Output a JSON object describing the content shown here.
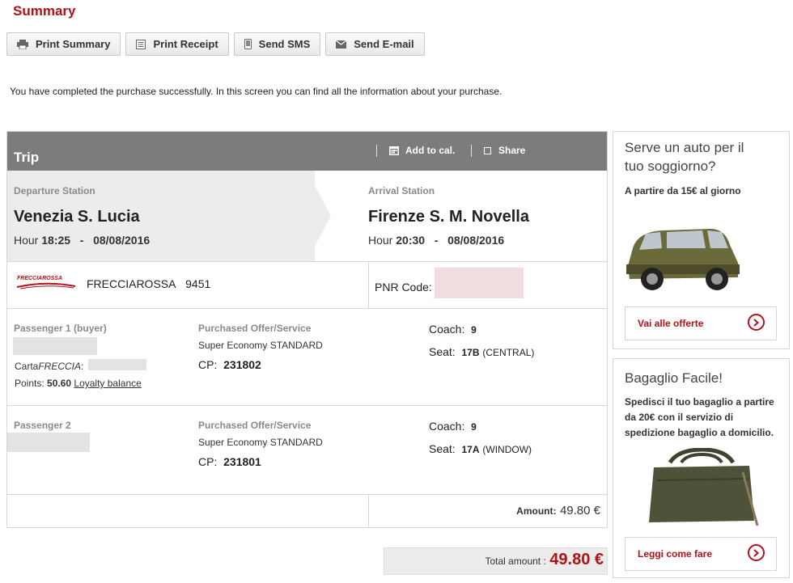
{
  "page": {
    "title": "Summary"
  },
  "toolbar": {
    "print_summary": "Print Summary",
    "print_receipt": "Print Receipt",
    "send_sms": "Send SMS",
    "send_email": "Send E-mail"
  },
  "message": "You have completed the purchase successfully. In this screen you can find all the information about your purchase.",
  "trip": {
    "header": "Trip",
    "add_to_cal": "Add to cal.",
    "share": "Share",
    "departure": {
      "label": "Departure Station",
      "station": "Venezia S. Lucia",
      "hour_label": "Hour",
      "time": "18:25",
      "date": "08/08/2016"
    },
    "arrival": {
      "label": "Arrival Station",
      "station": "Firenze S. M. Novella",
      "hour_label": "Hour",
      "time": "20:30",
      "date": "08/08/2016"
    },
    "dash": "-",
    "train": {
      "brand": "FRECCIAROSSA",
      "name": "FRECCIAROSSA",
      "number": "9451"
    },
    "pnr_label": "PNR Code:",
    "passengers": [
      {
        "title": "Passenger 1  (buyer)",
        "card_label_prefix": "Carta",
        "card_label_italic": "FRECCIA",
        "card_label_suffix": ":",
        "points_label": "Points:",
        "points": "50.60",
        "loyalty_link": "Loyalty balance",
        "offer_label": "Purchased Offer/Service",
        "offer": "Super Economy STANDARD",
        "cp_label": "CP:",
        "cp": "231802",
        "coach_label": "Coach:",
        "coach": "9",
        "seat_label": "Seat:",
        "seat": "17B",
        "seat_pos": "(CENTRAL)"
      },
      {
        "title": "Passenger 2",
        "offer_label": "Purchased Offer/Service",
        "offer": "Super Economy STANDARD",
        "cp_label": "CP:",
        "cp": "231801",
        "coach_label": "Coach:",
        "coach": "9",
        "seat_label": "Seat:",
        "seat": "17A",
        "seat_pos": "(WINDOW)"
      }
    ],
    "amount_label": "Amount:",
    "amount": "49.80 €"
  },
  "total": {
    "label": "Total amount :",
    "value": "49.80 €"
  },
  "ads": [
    {
      "title_line1": "Serve un auto per il",
      "title_line2": "tuo soggiorno?",
      "subtitle": "A partire da 15€ al giorno",
      "link": "Vai alle offerte"
    },
    {
      "title": "Bagaglio Facile!",
      "line1": "Spedisci il tuo bagaglio a partire",
      "line2": "da 20€ con il servizio di",
      "line3": "spedizione bagaglio a domicilio.",
      "link": "Leggi come fare"
    }
  ],
  "colors": {
    "accent": "#b0121b",
    "header_bg": "#7c7c7c",
    "panel_bg": "#ececec"
  }
}
